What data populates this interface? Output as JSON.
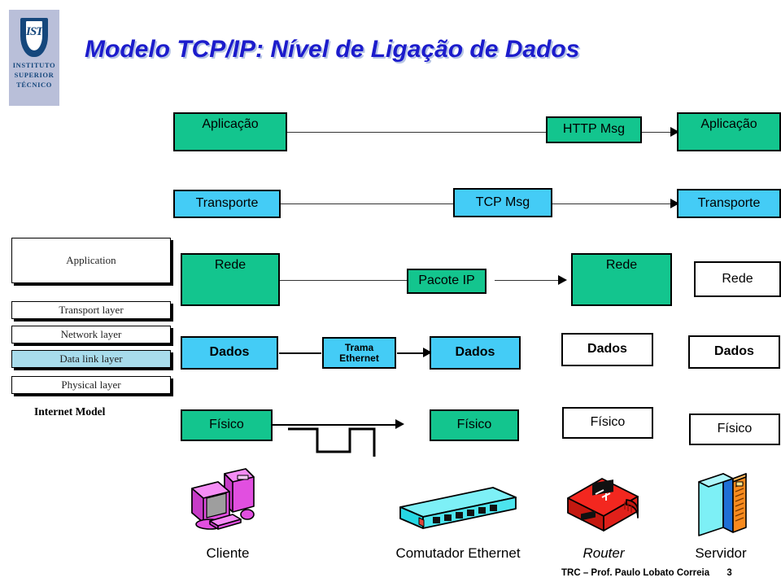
{
  "logo": {
    "name": "Instituto Superior Tecnico",
    "monogram": "IST",
    "line1": "INSTITUTO",
    "line2": "SUPERIOR",
    "line3": "TÉCNICO"
  },
  "title": "Modelo TCP/IP: Nível de Ligação de Dados",
  "colors": {
    "title": "#1c1ccc",
    "title_shadow": "#b6c4e4",
    "green": "#13c58e",
    "cyan": "#44ccf6",
    "white": "#ffffff",
    "logo_bg": "#b9bfd9",
    "logo_blue": "#15477c",
    "layer_highlight": "#a8dceb"
  },
  "internet_model": {
    "label": "Internet Model",
    "layers": [
      {
        "name": "Application",
        "highlighted": false
      },
      {
        "name": "Transport layer",
        "highlighted": false
      },
      {
        "name": "Network layer",
        "highlighted": false
      },
      {
        "name": "Data link layer",
        "highlighted": true
      },
      {
        "name": "Physical layer",
        "highlighted": false
      }
    ]
  },
  "stack_rows": [
    {
      "id": "application",
      "color": "green",
      "boxes": [
        {
          "label": "Aplicação",
          "col": "client",
          "fill": "green",
          "bold": false
        },
        {
          "label": "Aplicação",
          "col": "server",
          "fill": "green",
          "bold": false
        }
      ],
      "pdu": {
        "label": "HTTP Msg",
        "fill": "green"
      }
    },
    {
      "id": "transport",
      "color": "cyan",
      "boxes": [
        {
          "label": "Transporte",
          "col": "client",
          "fill": "cyan",
          "bold": false
        },
        {
          "label": "Transporte",
          "col": "server",
          "fill": "cyan",
          "bold": false
        }
      ],
      "pdu": {
        "label": "TCP Msg",
        "fill": "cyan"
      }
    },
    {
      "id": "network",
      "color": "green",
      "boxes": [
        {
          "label": "Rede",
          "col": "client",
          "fill": "green",
          "bold": false
        },
        {
          "label": "Rede",
          "col": "router",
          "fill": "green",
          "bold": false
        },
        {
          "label": "Rede",
          "col": "server",
          "fill": "white",
          "bold": false
        }
      ],
      "pdu": {
        "label": "Pacote IP",
        "fill": "green"
      }
    },
    {
      "id": "datalink",
      "color": "cyan",
      "boxes": [
        {
          "label": "Dados",
          "col": "client",
          "fill": "cyan",
          "bold": true
        },
        {
          "label": "Dados",
          "col": "switch",
          "fill": "cyan",
          "bold": true
        },
        {
          "label": "Dados",
          "col": "router",
          "fill": "white",
          "bold": true
        },
        {
          "label": "Dados",
          "col": "server",
          "fill": "white",
          "bold": true
        }
      ],
      "pdu": {
        "label_line1": "Trama",
        "label_line2": "Ethernet",
        "fill": "cyan"
      }
    },
    {
      "id": "physical",
      "color": "green",
      "boxes": [
        {
          "label": "Físico",
          "col": "client",
          "fill": "green",
          "bold": false
        },
        {
          "label": "Físico",
          "col": "switch",
          "fill": "green",
          "bold": false
        },
        {
          "label": "Físico",
          "col": "router",
          "fill": "white",
          "bold": false
        },
        {
          "label": "Físico",
          "col": "server",
          "fill": "white",
          "bold": false
        }
      ],
      "pdu": {
        "label": "",
        "fill": "none"
      }
    }
  ],
  "devices": [
    {
      "key": "client",
      "label": "Cliente",
      "icon": "desktop-computer-icon",
      "italic": false
    },
    {
      "key": "switch",
      "label": "Comutador Ethernet",
      "icon": "ethernet-switch-icon",
      "italic": false
    },
    {
      "key": "router",
      "label": "Router",
      "icon": "router-icon",
      "italic": true
    },
    {
      "key": "server",
      "label": "Servidor",
      "icon": "server-tower-icon",
      "italic": false
    }
  ],
  "labels": {
    "app_client": "Aplicação",
    "app_server": "Aplicação",
    "http_msg": "HTTP Msg",
    "tra_client": "Transporte",
    "tra_server": "Transporte",
    "tcp_msg": "TCP Msg",
    "rede_client": "Rede",
    "rede_router": "Rede",
    "rede_server": "Rede",
    "pacote_ip": "Pacote IP",
    "dados_client": "Dados",
    "dados_switch": "Dados",
    "dados_router": "Dados",
    "dados_server": "Dados",
    "trama_l1": "Trama",
    "trama_l2": "Ethernet",
    "fis_client": "Físico",
    "fis_switch": "Físico",
    "fis_router": "Físico",
    "fis_server": "Físico",
    "dev_client": "Cliente",
    "dev_switch": "Comutador Ethernet",
    "dev_router": "Router",
    "dev_server": "Servidor"
  },
  "footer": {
    "text": "TRC – Prof. Paulo Lobato Correia",
    "page": "3"
  }
}
